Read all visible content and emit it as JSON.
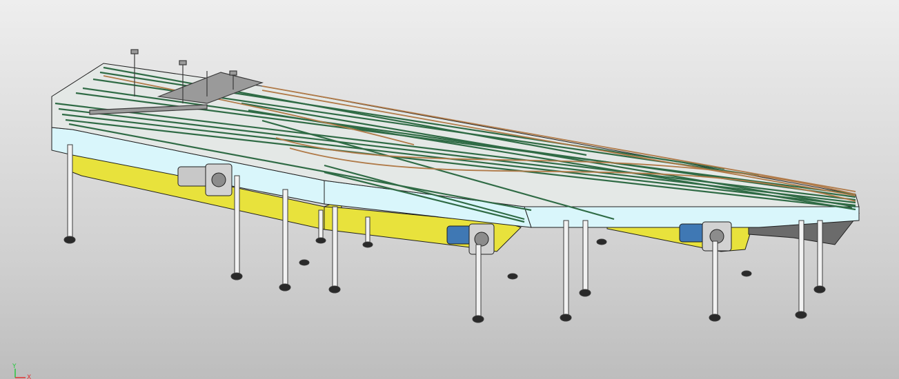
{
  "viewport": {
    "background_top": "#eeeeee",
    "background_bottom": "#bdbdbd"
  },
  "model": {
    "colors": {
      "frame_panel": "#d9f6fb",
      "base_plate": "#e8e23c",
      "chain_track": "#2f6b45",
      "guide_rail": "#b07a48",
      "leg": "#f2f2f2",
      "motor_grey": "#c8c8c8",
      "motor_blue": "#3f78b4",
      "outline": "#1e1e1e"
    },
    "parts": [
      "conveyor-frame",
      "chain-tracks",
      "guide-rails",
      "drive-motors",
      "support-legs",
      "base-plates"
    ]
  },
  "triad": {
    "y_label": "Y",
    "x_label": "X",
    "y_color": "#27c93f",
    "x_color": "#e03030"
  }
}
